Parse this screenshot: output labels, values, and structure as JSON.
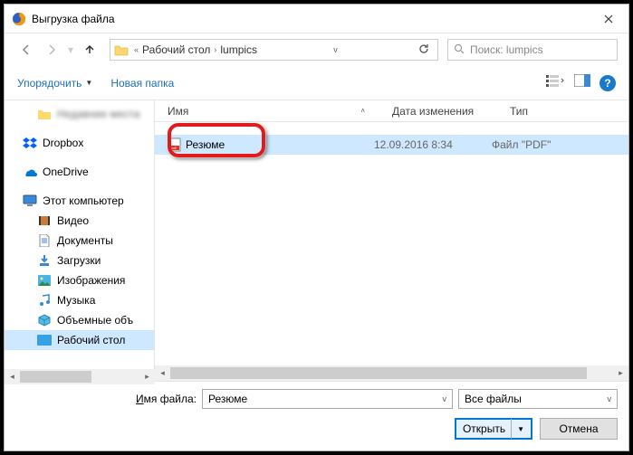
{
  "window": {
    "title": "Выгрузка файла"
  },
  "nav": {
    "breadcrumb": {
      "part1": "Рабочий стол",
      "part2": "lumpics"
    },
    "search_placeholder": "Поиск: lumpics"
  },
  "toolbar": {
    "organize": "Упорядочить",
    "newfolder": "Новая папка"
  },
  "columns": {
    "name": "Имя",
    "date": "Дата изменения",
    "type": "Тип"
  },
  "file": {
    "name": "Резюме",
    "date": "12.09.2016 8:34",
    "type": "Файл \"PDF\""
  },
  "sidebar": {
    "blurred": "Недавние места",
    "dropbox": "Dropbox",
    "onedrive": "OneDrive",
    "thispc": "Этот компьютер",
    "video": "Видео",
    "documents": "Документы",
    "downloads": "Загрузки",
    "pictures": "Изображения",
    "music": "Музыка",
    "objects3d": "Объемные объ",
    "desktop": "Рабочий стол"
  },
  "bottom": {
    "filename_label_pre": "И",
    "filename_label_post": "мя файла:",
    "filename_value": "Резюме",
    "filter": "Все файлы",
    "open": "Открыть",
    "cancel": "Отмена"
  }
}
